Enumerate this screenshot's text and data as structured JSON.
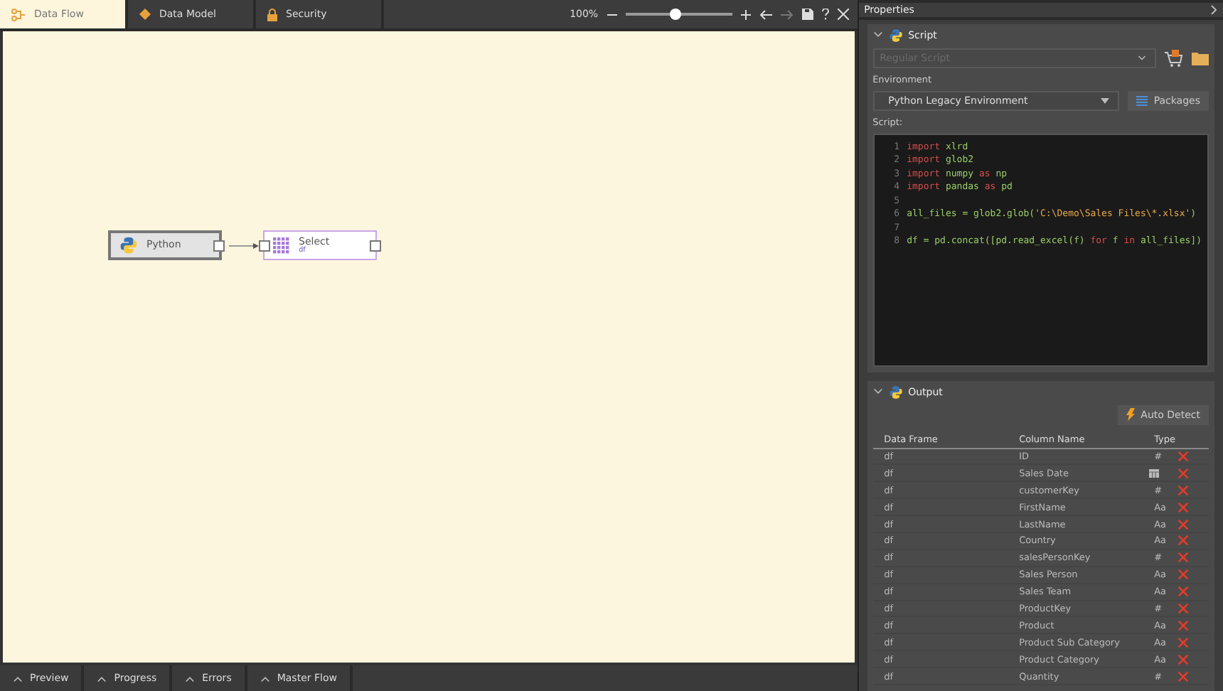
{
  "tabs": [
    {
      "label": "Data Flow",
      "selected": true
    },
    {
      "label": "Data Model",
      "selected": false
    },
    {
      "label": "Security",
      "selected": false
    }
  ],
  "zoom": {
    "reading": "100%",
    "level": 0.47
  },
  "nodes": [
    {
      "label": "Python",
      "kind": "python",
      "selected": true
    },
    {
      "label": "Select",
      "sub": "df",
      "kind": "select",
      "selected": false
    }
  ],
  "bottom_tabs": [
    "Preview",
    "Progress",
    "Errors",
    "Master Flow"
  ],
  "properties": {
    "title": "Properties",
    "script": {
      "title": "Script",
      "script_type": "Regular Script",
      "environment_label": "Environment",
      "environment": "Python Legacy Environment",
      "packages_button": "Packages",
      "script_label": "Script:",
      "lines": [
        {
          "number": "1",
          "tokens": [
            {
              "text": "import ",
              "kind": "keyword"
            },
            {
              "text": "xlrd",
              "kind": "name"
            }
          ]
        },
        {
          "number": "2",
          "tokens": [
            {
              "text": "import ",
              "kind": "keyword"
            },
            {
              "text": "glob2",
              "kind": "name"
            }
          ]
        },
        {
          "number": "3",
          "tokens": [
            {
              "text": "import ",
              "kind": "keyword"
            },
            {
              "text": "numpy ",
              "kind": "name"
            },
            {
              "text": "as ",
              "kind": "keyword"
            },
            {
              "text": "np",
              "kind": "name"
            }
          ]
        },
        {
          "number": "4",
          "tokens": [
            {
              "text": "import ",
              "kind": "keyword"
            },
            {
              "text": "pandas ",
              "kind": "name"
            },
            {
              "text": "as ",
              "kind": "keyword"
            },
            {
              "text": "pd",
              "kind": "name"
            }
          ]
        },
        {
          "number": "5"
        },
        {
          "number": "6",
          "tokens": [
            {
              "text": "all_files = glob2.glob(",
              "kind": "name"
            },
            {
              "text": "'C:\\Demo\\Sales Files\\*.xlsx'",
              "kind": "string"
            },
            {
              "text": ")",
              "kind": "name"
            }
          ]
        },
        {
          "number": "7"
        },
        {
          "number": "8",
          "tokens": [
            {
              "text": "df = pd.concat([pd.read_excel(f) ",
              "kind": "name"
            },
            {
              "text": "for ",
              "kind": "keyword"
            },
            {
              "text": "f ",
              "kind": "name"
            },
            {
              "text": "in ",
              "kind": "keyword"
            },
            {
              "text": "all_files])",
              "kind": "name"
            }
          ]
        }
      ]
    },
    "output": {
      "title": "Output",
      "auto_detect_button": "Auto Detect",
      "columns": [
        "Data Frame",
        "Column Name",
        "Type"
      ],
      "rows": [
        {
          "frame": "df",
          "column": "ID",
          "kind": "number",
          "type": "#"
        },
        {
          "frame": "df",
          "column": "Sales Date",
          "kind": "date"
        },
        {
          "frame": "df",
          "column": "customerKey",
          "kind": "number",
          "type": "#"
        },
        {
          "frame": "df",
          "column": "FirstName",
          "kind": "text",
          "type": "Aa"
        },
        {
          "frame": "df",
          "column": "LastName",
          "kind": "text",
          "type": "Aa"
        },
        {
          "frame": "df",
          "column": "Country",
          "kind": "text",
          "type": "Aa"
        },
        {
          "frame": "df",
          "column": "salesPersonKey",
          "kind": "number",
          "type": "#"
        },
        {
          "frame": "df",
          "column": "Sales Person",
          "kind": "text",
          "type": "Aa"
        },
        {
          "frame": "df",
          "column": "Sales Team",
          "kind": "text",
          "type": "Aa"
        },
        {
          "frame": "df",
          "column": "ProductKey",
          "kind": "number",
          "type": "#"
        },
        {
          "frame": "df",
          "column": "Product",
          "kind": "text",
          "type": "Aa"
        },
        {
          "frame": "df",
          "column": "Product Sub Category",
          "kind": "text",
          "type": "Aa"
        },
        {
          "frame": "df",
          "column": "Product Category",
          "kind": "text",
          "type": "Aa"
        },
        {
          "frame": "df",
          "column": "Quantity",
          "kind": "number",
          "type": "#"
        }
      ]
    }
  }
}
